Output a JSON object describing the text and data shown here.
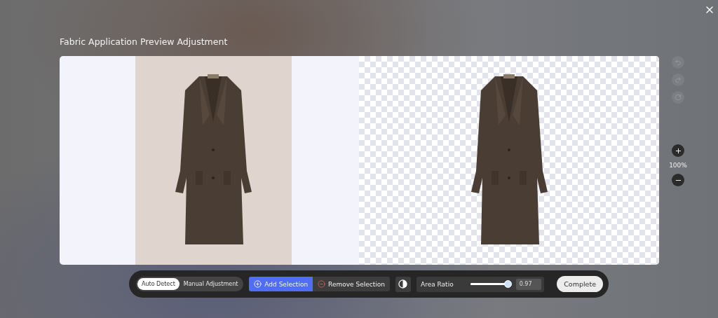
{
  "title": "Fabric Application Preview Adjustment",
  "history_buttons": [
    {
      "kind": "undo",
      "disabled": true
    },
    {
      "kind": "redo",
      "disabled": true
    },
    {
      "kind": "reset",
      "disabled": true
    }
  ],
  "zoom": {
    "label": "100%"
  },
  "modes": [
    {
      "label": "Auto Detect",
      "selected": true
    },
    {
      "label": "Manual Adjustment",
      "selected": false
    }
  ],
  "selection_tools": [
    {
      "label": "Add Selection",
      "kind": "add",
      "selected": true
    },
    {
      "label": "Remove Selection",
      "kind": "remove",
      "selected": false
    }
  ],
  "area_ratio": {
    "label": "Area Ratio",
    "level": 0.97,
    "value": "0.97"
  },
  "complete_button": "Complete"
}
